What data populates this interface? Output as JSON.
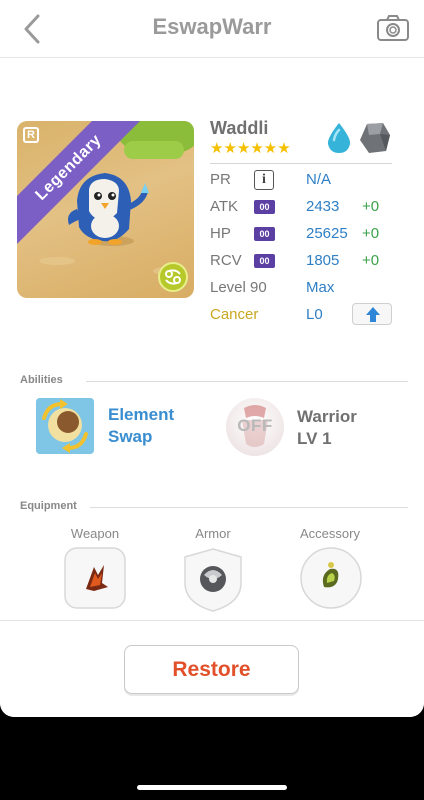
{
  "header": {
    "title": "EswapWarr",
    "back_icon": "chevron-left-icon",
    "camera_icon": "camera-icon"
  },
  "monster": {
    "name": "Waddli",
    "rarity_badge": "R",
    "rarity_label": "Legendary",
    "stars": "★★★★★★",
    "star_count": 6,
    "elements": [
      "water",
      "stone"
    ],
    "zodiac_icon": "cancer-zodiac-icon"
  },
  "stats": {
    "pr": {
      "label": "PR",
      "value": "N/A"
    },
    "atk": {
      "label": "ATK",
      "chip": "00",
      "value": "2433",
      "bonus": "+0"
    },
    "hp": {
      "label": "HP",
      "chip": "00",
      "value": "25625",
      "bonus": "+0"
    },
    "rcv": {
      "label": "RCV",
      "chip": "00",
      "value": "1805",
      "bonus": "+0"
    },
    "level": {
      "label": "Level 90",
      "value": "Max"
    },
    "zodiac": {
      "label": "Cancer",
      "value": "L0"
    }
  },
  "abilities": {
    "section_label": "Abilities",
    "ability_name_line1": "Element",
    "ability_name_line2": "Swap",
    "awaken_state": "OFF",
    "awaken_name_line1": "Warrior",
    "awaken_name_line2": "LV 1"
  },
  "equipment": {
    "section_label": "Equipment",
    "slots": [
      {
        "label": "Weapon"
      },
      {
        "label": "Armor"
      },
      {
        "label": "Accessory"
      }
    ]
  },
  "footer": {
    "restore_label": "Restore"
  },
  "colors": {
    "accent_blue": "#2f7fc4",
    "bonus_green": "#3aa24a",
    "restore_orange": "#e1502a",
    "legendary_purple": "#7b5fc4",
    "cancer_gold": "#c9a722"
  }
}
